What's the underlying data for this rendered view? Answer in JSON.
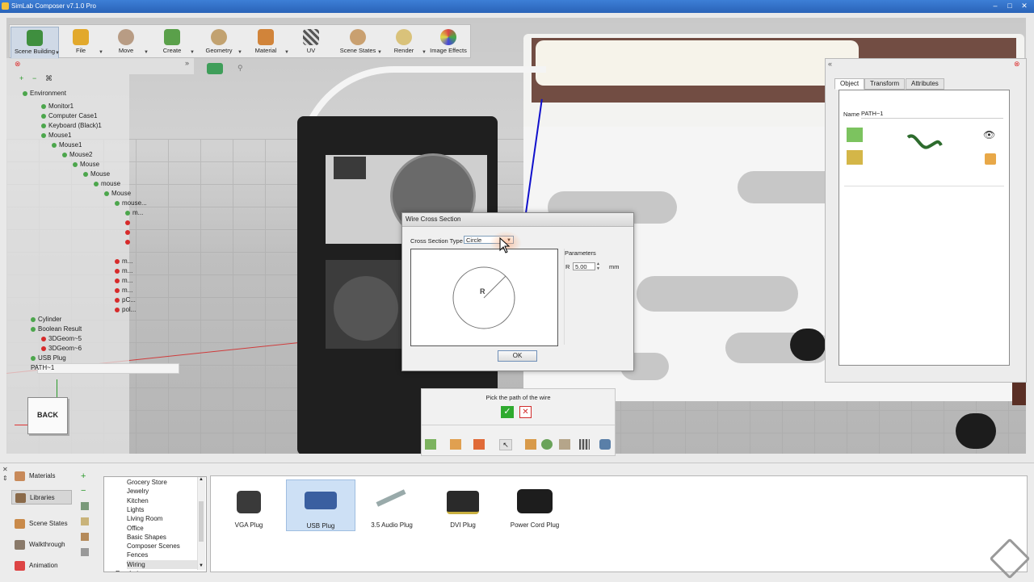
{
  "window": {
    "title": "SimLab Composer v7.1.0 Pro"
  },
  "toolbar": {
    "buttons": [
      {
        "label": "Scene Building"
      },
      {
        "label": "File"
      },
      {
        "label": "Move"
      },
      {
        "label": "Create"
      },
      {
        "label": "Geometry"
      },
      {
        "label": "Material"
      },
      {
        "label": "UV"
      },
      {
        "label": "Scene States"
      },
      {
        "label": "Render"
      },
      {
        "label": "Image Effects"
      }
    ]
  },
  "tree": {
    "items": [
      {
        "label": "Environment"
      },
      {
        "label": "Monitor1"
      },
      {
        "label": "Computer Case1"
      },
      {
        "label": "Keyboard (Black)1"
      },
      {
        "label": "Mouse1"
      },
      {
        "label": "Mouse1"
      },
      {
        "label": "Mouse2"
      },
      {
        "label": "Mouse"
      },
      {
        "label": "Mouse"
      },
      {
        "label": "mouse"
      },
      {
        "label": "Mouse"
      },
      {
        "label": "mouse..."
      },
      {
        "label": "m..."
      },
      {
        "label": ""
      },
      {
        "label": ""
      },
      {
        "label": ""
      },
      {
        "label": "m..."
      },
      {
        "label": "m..."
      },
      {
        "label": "m..."
      },
      {
        "label": "m..."
      },
      {
        "label": "pC..."
      },
      {
        "label": "pol..."
      },
      {
        "label": "Cylinder"
      },
      {
        "label": "Boolean Result"
      },
      {
        "label": "3DGeom~5"
      },
      {
        "label": "3DGeom~6"
      },
      {
        "label": "USB Plug"
      },
      {
        "label": "PATH~1"
      }
    ]
  },
  "viewcube": {
    "label": "BACK"
  },
  "properties": {
    "tabs": [
      {
        "label": "Object"
      },
      {
        "label": "Transform"
      },
      {
        "label": "Attributes"
      }
    ],
    "name_label": "Name",
    "name_value": "PATH~1"
  },
  "dialog": {
    "title": "Wire Cross Section",
    "cross_section_label": "Cross Section Type",
    "cross_section_value": "Circle",
    "preview_label": "R",
    "parameters_label": "Parameters",
    "r_label": "R",
    "r_value": "5.00",
    "r_unit": "mm",
    "ok_label": "OK"
  },
  "pick_panel": {
    "message": "Pick the path of the wire"
  },
  "bottom_nav": [
    {
      "label": "Materials"
    },
    {
      "label": "Libraries"
    },
    {
      "label": "Scene States"
    },
    {
      "label": "Walkthrough"
    },
    {
      "label": "Animation"
    }
  ],
  "categories": [
    {
      "label": "Grocery Store"
    },
    {
      "label": "Jewelry"
    },
    {
      "label": "Kitchen"
    },
    {
      "label": "Lights"
    },
    {
      "label": "Living Room"
    },
    {
      "label": "Office"
    },
    {
      "label": "Basic Shapes"
    },
    {
      "label": "Composer Scenes"
    },
    {
      "label": "Fences"
    },
    {
      "label": "Wiring"
    },
    {
      "label": "Rendering"
    }
  ],
  "library_items": [
    {
      "label": "VGA Plug"
    },
    {
      "label": "USB Plug"
    },
    {
      "label": "3.5 Audio Plug"
    },
    {
      "label": "DVI Plug"
    },
    {
      "label": "Power Cord Plug"
    }
  ],
  "colors": {
    "titlebar": "#2a63b8",
    "selection": "#cde0f5",
    "accept": "#2faa2f",
    "reject": "#d12b2b"
  }
}
